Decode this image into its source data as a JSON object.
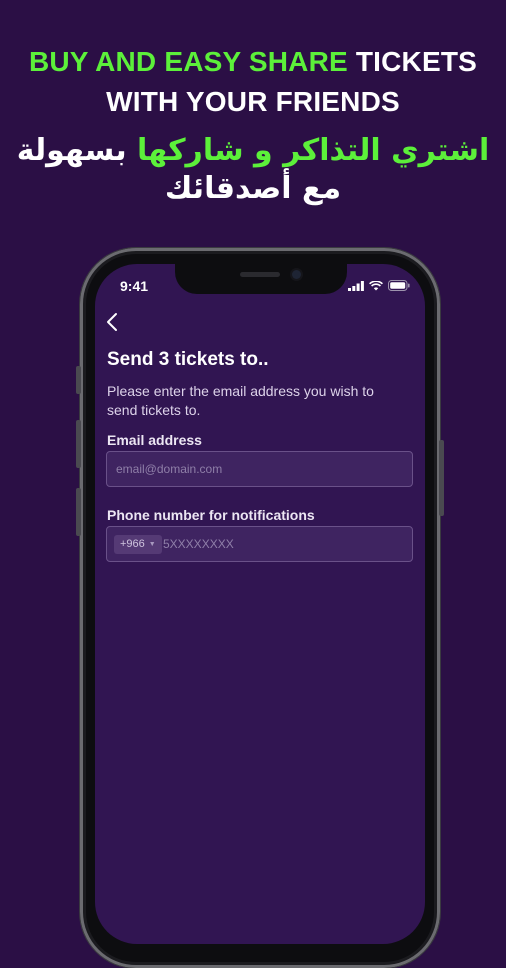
{
  "promo": {
    "line1_green": "BUY AND EASY SHARE",
    "line1_white": " TICKETS",
    "line2": "WITH YOUR FRIENDS",
    "ar_line1_green": "اشتري التذاكر و شاركها",
    "ar_line1_white": " بسهولة",
    "ar_line2": "مع أصدقائك"
  },
  "status_bar": {
    "time": "9:41",
    "icons": [
      "signal-icon",
      "wifi-icon",
      "battery-icon"
    ]
  },
  "screen": {
    "back_icon": "chevron-left-icon",
    "title": "Send 3 tickets to..",
    "subtitle": "Please enter the email address you wish to send tickets to.",
    "email": {
      "label": "Email address",
      "placeholder": "email@domain.com",
      "value": ""
    },
    "phone": {
      "label": "Phone number for notifications",
      "country_code": "+966",
      "placeholder": "5XXXXXXXX",
      "value": ""
    }
  },
  "colors": {
    "background": "#2b0f45",
    "screen_bg": "#311552",
    "accent_green": "#5cf03a",
    "field_bg": "#3f2461",
    "field_border": "#6a5189"
  }
}
